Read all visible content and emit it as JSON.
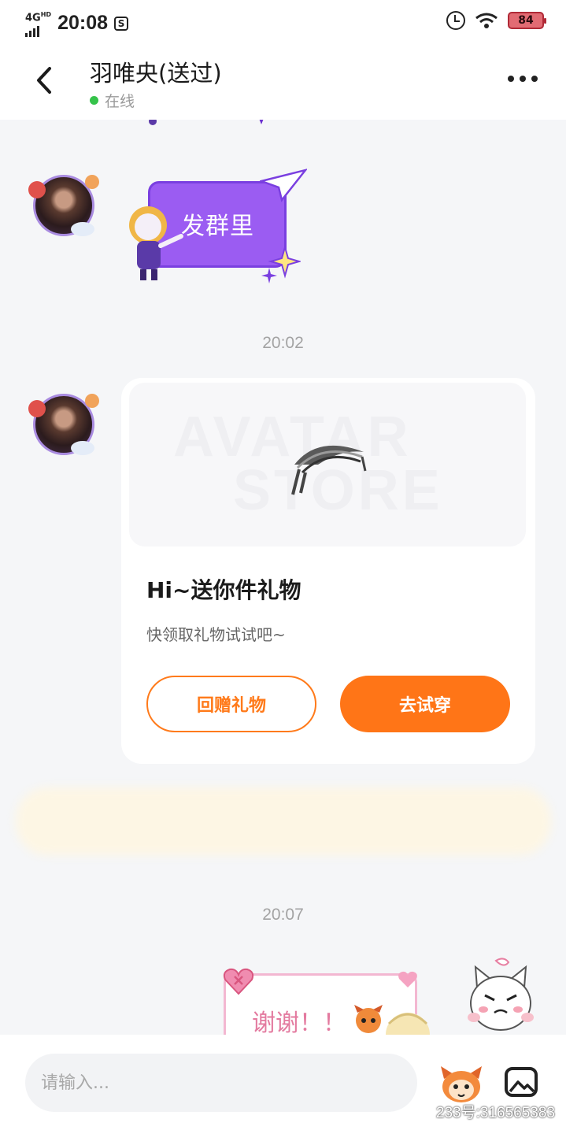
{
  "status_bar": {
    "network": "4G",
    "network_sup": "HD",
    "time": "20:08",
    "app_icon_glyph": "S",
    "battery": "84",
    "icons": [
      "signal-icon",
      "alarm-icon",
      "wifi-icon",
      "battery-icon"
    ]
  },
  "header": {
    "title": "羽唯央(送过)",
    "status": "在线",
    "status_color": "#35c34a"
  },
  "messages": {
    "sticker1_text": "发群里",
    "time1": "20:02",
    "gift": {
      "banner_word1": "AVATAR",
      "banner_word2": "STORE",
      "title": "Hi~送你件礼物",
      "subtitle": "快领取礼物试试吧~",
      "return_button": "回赠礼物",
      "try_button": "去试穿"
    },
    "time2": "20:07",
    "sticker2_text": "谢谢！！"
  },
  "input": {
    "placeholder": "请输入..."
  },
  "watermark": "233号:316565383",
  "colors": {
    "accent": "#ff7517",
    "sticker_purple": "#9b5cf2",
    "bubble_bg": "#ffffff",
    "chat_bg": "#f5f6f8"
  }
}
